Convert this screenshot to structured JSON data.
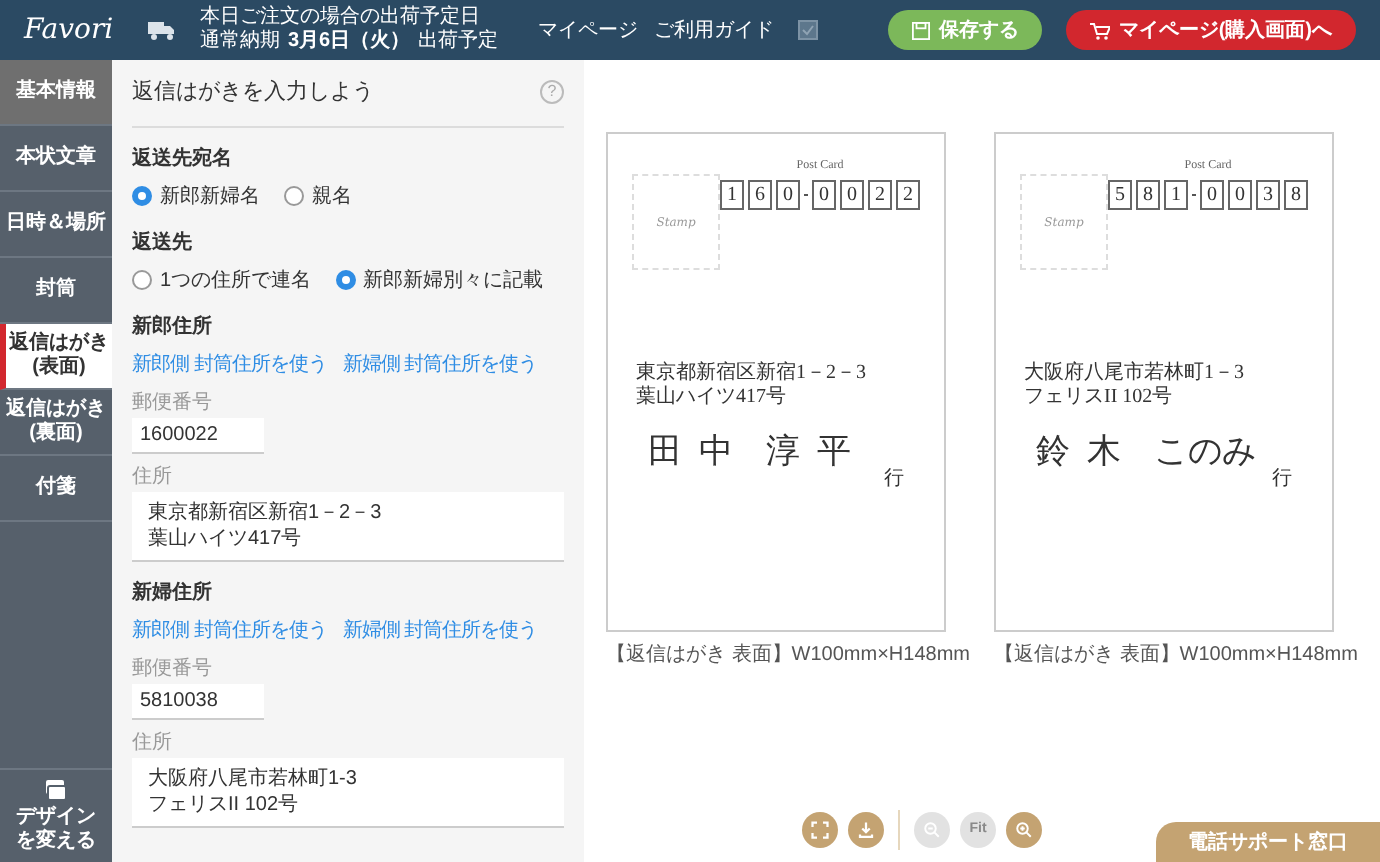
{
  "header": {
    "logo": "Favori",
    "shipping_note": "本日ご注文の場合の出荷予定日",
    "shipping_label": "通常納期",
    "shipping_date": "3月6日（火）",
    "shipping_suffix": "出荷予定",
    "nav": [
      "マイページ",
      "ご利用ガイド"
    ],
    "save_button": "保存する",
    "mypage_button": "マイページ(購入画面)へ"
  },
  "sidebar": {
    "items": [
      {
        "label": "基本情報",
        "selected": false,
        "highlighted": true
      },
      {
        "label": "本状文章",
        "selected": false,
        "highlighted": false
      },
      {
        "label": "日時＆場所",
        "selected": false,
        "highlighted": false
      },
      {
        "label": "封筒",
        "selected": false,
        "highlighted": false
      },
      {
        "label": "返信はがき\n(表面)",
        "selected": true,
        "highlighted": false
      },
      {
        "label": "返信はがき\n(裏面)",
        "selected": false,
        "highlighted": false
      },
      {
        "label": "付箋",
        "selected": false,
        "highlighted": false
      }
    ],
    "design_button": "デザインを変える"
  },
  "form": {
    "title": "返信はがきを入力しよう",
    "help": "?",
    "sections": [
      {
        "kind": "radio",
        "label": "返送先宛名",
        "options": [
          {
            "label": "新郎新婦名",
            "selected": true
          },
          {
            "label": "親名",
            "selected": false
          }
        ]
      },
      {
        "kind": "radio",
        "label": "返送先",
        "options": [
          {
            "label": "1つの住所で連名",
            "selected": false
          },
          {
            "label": "新郎新婦別々に記載",
            "selected": true
          }
        ]
      },
      {
        "kind": "address",
        "label": "新郎住所",
        "links": [
          "新郎側 封筒住所を使う",
          "新婦側 封筒住所を使う"
        ],
        "postal_label": "郵便番号",
        "postal_value": "1600022",
        "address_label": "住所",
        "address_value": "東京都新宿区新宿1－2－3\n葉山ハイツ417号"
      },
      {
        "kind": "address",
        "label": "新婦住所",
        "links": [
          "新郎側 封筒住所を使う",
          "新婦側 封筒住所を使う"
        ],
        "postal_label": "郵便番号",
        "postal_value": "5810038",
        "address_label": "住所",
        "address_value": "大阪府八尾市若林町1-3\nフェリスII 102号"
      }
    ]
  },
  "previews": [
    {
      "post_card": "Post Card",
      "stamp": "Stamp",
      "postal_digits": [
        "1",
        "6",
        "0",
        "0",
        "0",
        "2",
        "2"
      ],
      "address": [
        "東京都新宿区新宿1－2－3",
        "葉山ハイツ417号"
      ],
      "surname": "田中",
      "given_name": "淳平",
      "honorific": "行",
      "caption": "【返信はがき 表面】W100mm×H148mm"
    },
    {
      "post_card": "Post Card",
      "stamp": "Stamp",
      "postal_digits": [
        "5",
        "8",
        "1",
        "0",
        "0",
        "3",
        "8"
      ],
      "address": [
        "大阪府八尾市若林町1－3",
        "フェリスII 102号"
      ],
      "surname": "鈴木",
      "given_name": "このみ",
      "honorific": "行",
      "caption": "【返信はがき 表面】W100mm×H148mm"
    }
  ],
  "toolbar": [
    {
      "kind": "fullscreen",
      "disabled": false
    },
    {
      "kind": "download",
      "disabled": false
    },
    {
      "kind": "zoom_out",
      "disabled": true
    },
    {
      "kind": "fit",
      "label": "Fit",
      "disabled": true
    },
    {
      "kind": "zoom_in",
      "disabled": false
    }
  ],
  "support_tab": "電話サポート窓口"
}
